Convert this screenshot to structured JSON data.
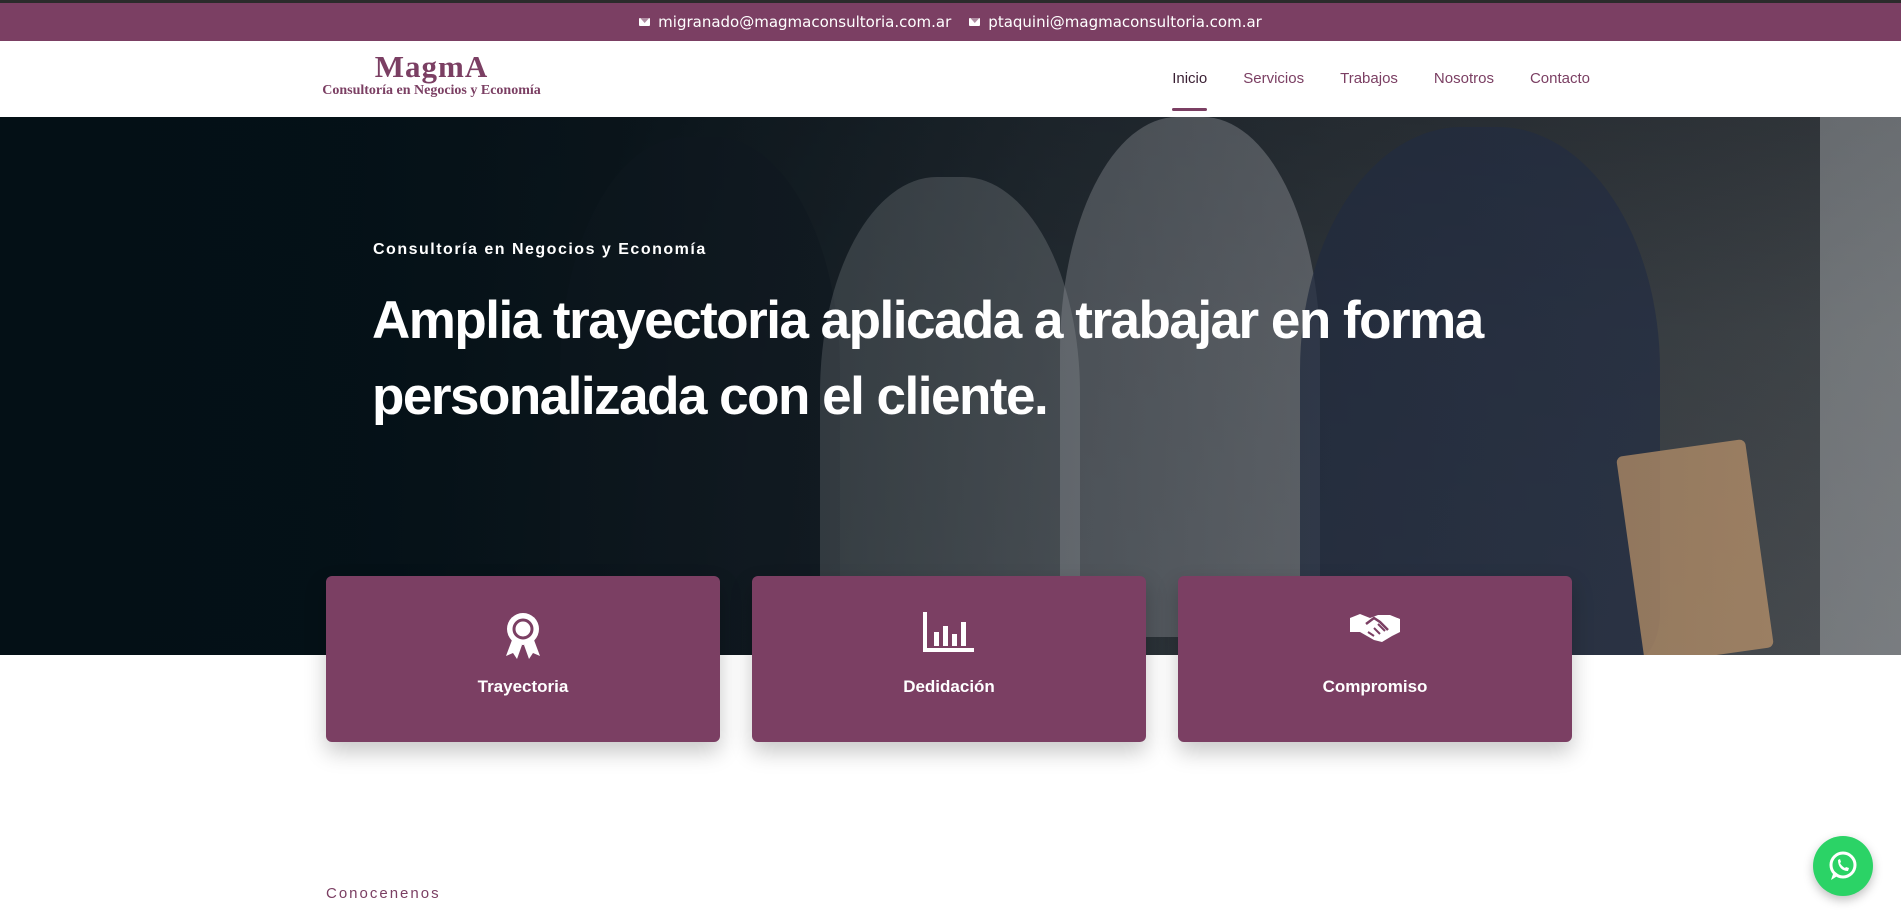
{
  "topbar": {
    "email_1": "migranado@magmaconsultoria.com.ar",
    "email_2": "ptaquini@magmaconsultoria.com.ar"
  },
  "header": {
    "logo_main": "MagmA",
    "logo_sub": "Consultoría en Negocios y Economía",
    "nav": [
      {
        "label": "Inicio",
        "active": true
      },
      {
        "label": "Servicios"
      },
      {
        "label": "Trabajos"
      },
      {
        "label": "Nosotros"
      },
      {
        "label": "Contacto"
      }
    ]
  },
  "hero": {
    "kicker": "Consultoría en Negocios y Economía",
    "title": "Amplia trayectoria aplicada a trabajar en forma personalizada con el cliente."
  },
  "cards": [
    {
      "label": "Trayectoria",
      "icon": "award-icon"
    },
    {
      "label": "Dedidación",
      "icon": "bar-chart-icon"
    },
    {
      "label": "Compromiso",
      "icon": "handshake-icon"
    }
  ],
  "section": {
    "label": "Conocenenos"
  },
  "colors": {
    "brand": "#7b3f63",
    "whatsapp": "#2bd366"
  }
}
